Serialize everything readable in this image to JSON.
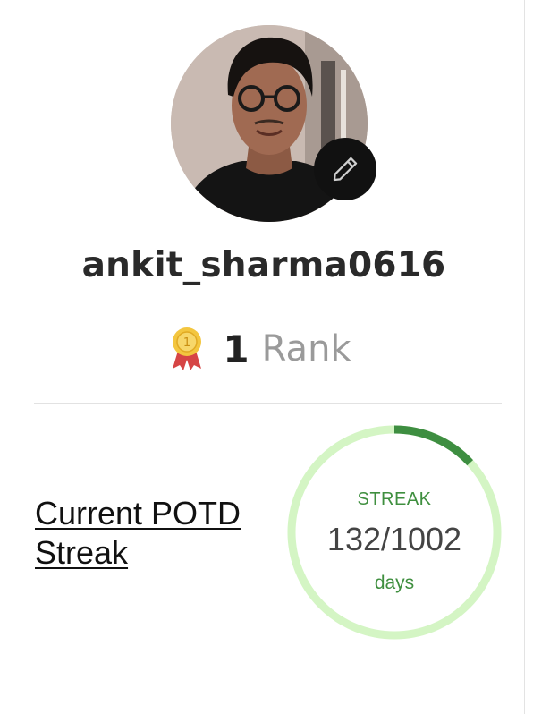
{
  "profile": {
    "username": "ankit_sharma0616",
    "avatar_alt": "profile-photo",
    "edit_icon": "pencil-icon"
  },
  "rank": {
    "icon": "medal-icon",
    "value": "1",
    "label": "Rank"
  },
  "potd": {
    "title": "Current POTD Streak",
    "ring_label": "STREAK",
    "current": "132",
    "total": "1002",
    "value_text": "132/1002",
    "unit": "days",
    "progress_fraction": 0.1317
  },
  "colors": {
    "ring_track": "#d4f5c4",
    "ring_fill": "#3e8e41",
    "accent_green": "#3f8f3f",
    "edit_button": "#111111"
  }
}
